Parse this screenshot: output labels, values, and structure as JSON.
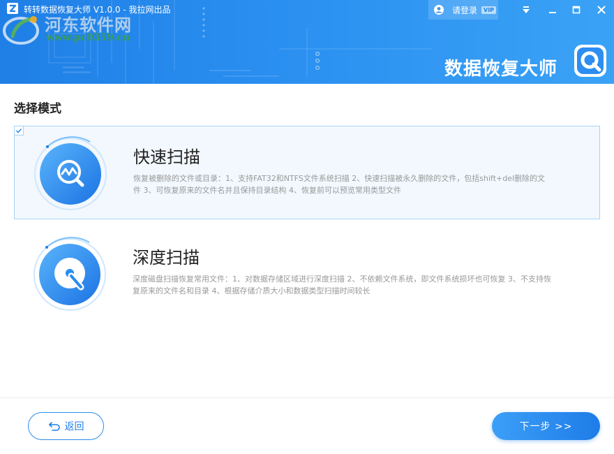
{
  "window": {
    "title": "转转数据恢复大师 V1.0.0 - 我拉网出品",
    "login_label": "请登录",
    "vip_badge": "VIP",
    "brand_name": "数据恢复大师"
  },
  "watermark": {
    "site_name": "河东软件网",
    "site_url": "www.pc0359.cn"
  },
  "main": {
    "section_title": "选择模式",
    "modes": [
      {
        "title": "快速扫描",
        "description": "恢复被删除的文件或目录：1、支持FAT32和NTFS文件系统扫描 2、快速扫描被永久删除的文件，包括shift+del删除的文件 3、可恢复原来的文件名并且保持目录结构 4、恢复前可以预览常用类型文件",
        "selected": true,
        "icon": "quick-scan-icon"
      },
      {
        "title": "深度扫描",
        "description": "深度磁盘扫描恢复常用文件：1、对数据存储区域进行深度扫描 2、不依赖文件系统，即文件系统损坏也可恢复 3、不支持恢复原来的文件名和目录 4、根据存储介质大小和数据类型扫描时间较长",
        "selected": false,
        "icon": "deep-scan-icon"
      }
    ]
  },
  "footer": {
    "back_label": "返回",
    "next_label": "下一步 >>"
  },
  "colors": {
    "header_blue": "#2a8ff0",
    "accent": "#1f7fe6",
    "selected_bg": "#f2f8fe",
    "selected_border": "#a8d2f7"
  }
}
